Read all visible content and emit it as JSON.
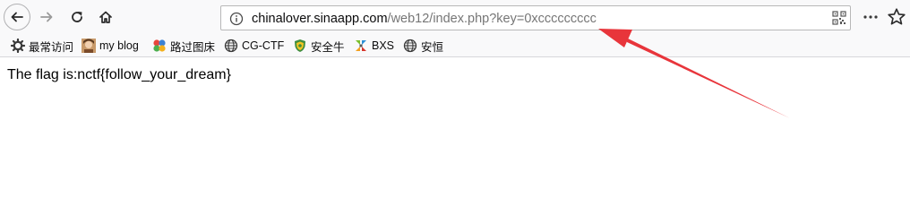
{
  "toolbar": {
    "back_icon": "arrow-left-icon",
    "forward_icon": "arrow-right-icon",
    "reload_icon": "reload-icon",
    "home_icon": "home-icon",
    "more_icon": "more-horizontal-icon",
    "star_icon": "star-icon"
  },
  "urlbar": {
    "host": "chinalover.sinaapp.com",
    "path": "/web12/index.php?key=0xccccccccc",
    "info_icon": "info-icon",
    "qr_icon": "qr-code-icon"
  },
  "bookmarks": [
    {
      "label": "最常访问",
      "icon": "gear-icon"
    },
    {
      "label": "my blog",
      "icon": "avatar-icon"
    },
    {
      "label": "路过图床",
      "icon": "flower-icon"
    },
    {
      "label": "CG-CTF",
      "icon": "globe-icon"
    },
    {
      "label": "安全牛",
      "icon": "shield-icon"
    },
    {
      "label": "BXS",
      "icon": "leaf-icon"
    },
    {
      "label": "安恒",
      "icon": "globe-icon"
    }
  ],
  "page": {
    "flag_text": "The flag is:nctf{follow_your_dream}"
  },
  "colors": {
    "toolbar_bg": "#f9f9fa",
    "annotation_arrow": "#e8353b"
  }
}
